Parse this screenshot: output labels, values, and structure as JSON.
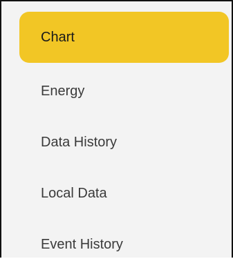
{
  "menu": {
    "active_color": "#f2c625",
    "items": [
      {
        "label": "Chart",
        "active": true
      },
      {
        "label": "Energy",
        "active": false
      },
      {
        "label": "Data History",
        "active": false
      },
      {
        "label": "Local Data",
        "active": false
      },
      {
        "label": "Event History",
        "active": false
      }
    ]
  }
}
